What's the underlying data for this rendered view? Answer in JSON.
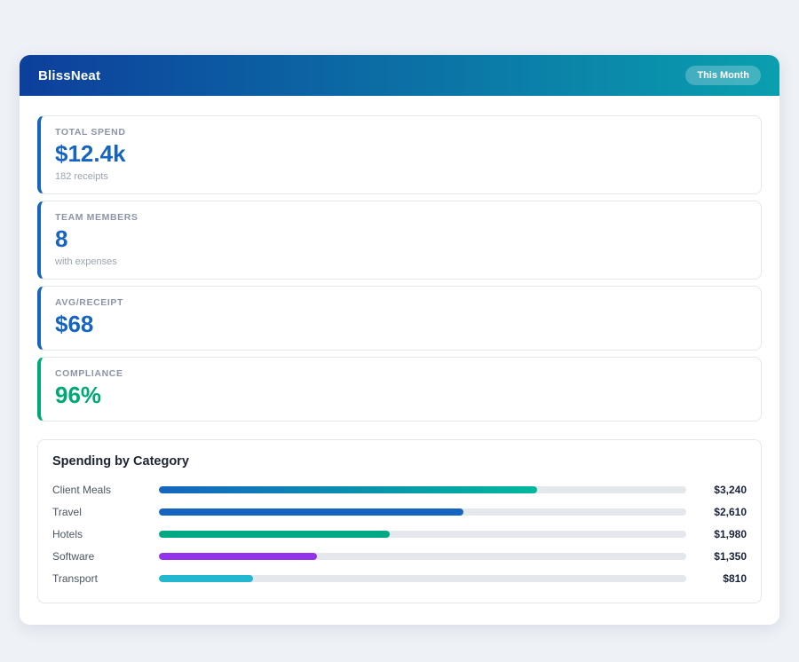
{
  "header": {
    "app_title": "BlissNeat",
    "period_badge": "This Month"
  },
  "colors": {
    "header_gradient_start": "#0d3f9c",
    "header_gradient_end": "#0a9fae",
    "stat_accent_blue": "#1565c0",
    "stat_accent_green": "#00a878",
    "bar_track": "#e4e7eb"
  },
  "stats": [
    {
      "label": "TOTAL SPEND",
      "value": "$12.4k",
      "sub": "182 receipts",
      "accent": "#1565c0",
      "value_color": "#1565c0"
    },
    {
      "label": "TEAM MEMBERS",
      "value": "8",
      "sub": "with expenses",
      "accent": "#1565c0",
      "value_color": "#1565c0"
    },
    {
      "label": "AVG/RECEIPT",
      "value": "$68",
      "accent": "#1565c0",
      "value_color": "#1565c0"
    },
    {
      "label": "COMPLIANCE",
      "value": "96%",
      "accent": "#00a878",
      "value_color": "#00a878"
    }
  ],
  "chart_data": {
    "type": "bar",
    "orientation": "horizontal",
    "title": "Spending by Category",
    "categories": [
      "Client Meals",
      "Travel",
      "Hotels",
      "Software",
      "Transport"
    ],
    "values": [
      3240,
      2610,
      1980,
      1350,
      810
    ],
    "value_labels": [
      "$3,240",
      "$2,610",
      "$1,980",
      "$1,350",
      "$810"
    ],
    "bar_colors": [
      "linear-gradient(90deg, #1565c0, #00b89e)",
      "#1565c0",
      "#00a884",
      "#9333ea",
      "#22b8cf"
    ],
    "xmax": 4520,
    "grid": false,
    "legend": false
  }
}
